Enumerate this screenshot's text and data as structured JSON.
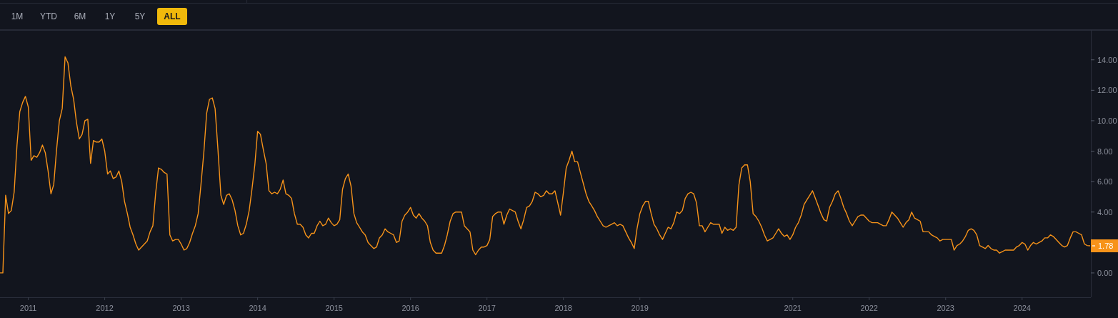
{
  "range_buttons": [
    {
      "label": "1M",
      "selected": false
    },
    {
      "label": "YTD",
      "selected": false
    },
    {
      "label": "6M",
      "selected": false
    },
    {
      "label": "1Y",
      "selected": false
    },
    {
      "label": "5Y",
      "selected": false
    },
    {
      "label": "ALL",
      "selected": true
    }
  ],
  "chart": {
    "current_value_label": "1.78",
    "chart_data": {
      "type": "line",
      "xlim": [
        2010.63,
        2024.89
      ],
      "ylim": [
        -1.6,
        15.96
      ],
      "x": [
        2010.63,
        2010.667,
        2010.704,
        2010.741,
        2010.778,
        2010.815,
        2010.852,
        2010.889,
        2010.926,
        2010.963,
        2011,
        2011.037,
        2011.074,
        2011.111,
        2011.148,
        2011.185,
        2011.222,
        2011.259,
        2011.296,
        2011.333,
        2011.37,
        2011.407,
        2011.444,
        2011.481,
        2011.519,
        2011.556,
        2011.593,
        2011.63,
        2011.667,
        2011.704,
        2011.741,
        2011.778,
        2011.815,
        2011.852,
        2011.889,
        2011.926,
        2011.963,
        2012,
        2012.037,
        2012.074,
        2012.111,
        2012.148,
        2012.185,
        2012.222,
        2012.259,
        2012.296,
        2012.333,
        2012.37,
        2012.407,
        2012.444,
        2012.481,
        2012.519,
        2012.556,
        2012.593,
        2012.63,
        2012.667,
        2012.704,
        2012.741,
        2012.778,
        2012.815,
        2012.852,
        2012.889,
        2012.926,
        2012.963,
        2013,
        2013.037,
        2013.074,
        2013.111,
        2013.148,
        2013.185,
        2013.222,
        2013.259,
        2013.296,
        2013.333,
        2013.37,
        2013.407,
        2013.444,
        2013.481,
        2013.519,
        2013.556,
        2013.593,
        2013.63,
        2013.667,
        2013.704,
        2013.741,
        2013.778,
        2013.815,
        2013.852,
        2013.889,
        2013.926,
        2013.963,
        2014,
        2014.037,
        2014.074,
        2014.111,
        2014.148,
        2014.185,
        2014.222,
        2014.259,
        2014.296,
        2014.333,
        2014.37,
        2014.407,
        2014.444,
        2014.481,
        2014.519,
        2014.556,
        2014.593,
        2014.63,
        2014.667,
        2014.704,
        2014.741,
        2014.778,
        2014.815,
        2014.852,
        2014.889,
        2014.926,
        2014.963,
        2015,
        2015.037,
        2015.074,
        2015.111,
        2015.148,
        2015.185,
        2015.222,
        2015.259,
        2015.296,
        2015.333,
        2015.37,
        2015.407,
        2015.444,
        2015.481,
        2015.519,
        2015.556,
        2015.593,
        2015.63,
        2015.667,
        2015.704,
        2015.741,
        2015.778,
        2015.815,
        2015.852,
        2015.889,
        2015.926,
        2015.963,
        2016,
        2016.037,
        2016.074,
        2016.111,
        2016.148,
        2016.185,
        2016.222,
        2016.259,
        2016.296,
        2016.333,
        2016.37,
        2016.407,
        2016.444,
        2016.481,
        2016.519,
        2016.556,
        2016.593,
        2016.63,
        2016.667,
        2016.704,
        2016.741,
        2016.778,
        2016.815,
        2016.852,
        2016.889,
        2016.926,
        2016.963,
        2017,
        2017.037,
        2017.074,
        2017.111,
        2017.148,
        2017.185,
        2017.222,
        2017.259,
        2017.296,
        2017.333,
        2017.37,
        2017.407,
        2017.444,
        2017.481,
        2017.519,
        2017.556,
        2017.593,
        2017.63,
        2017.667,
        2017.704,
        2017.741,
        2017.778,
        2017.815,
        2017.852,
        2017.889,
        2017.926,
        2017.963,
        2018,
        2018.037,
        2018.074,
        2018.111,
        2018.148,
        2018.185,
        2018.222,
        2018.259,
        2018.296,
        2018.333,
        2018.37,
        2018.407,
        2018.444,
        2018.481,
        2018.519,
        2018.556,
        2018.593,
        2018.63,
        2018.667,
        2018.704,
        2018.741,
        2018.778,
        2018.815,
        2018.852,
        2018.889,
        2018.926,
        2018.963,
        2019,
        2019.037,
        2019.074,
        2019.111,
        2019.148,
        2019.185,
        2019.222,
        2019.259,
        2019.296,
        2019.333,
        2019.37,
        2019.407,
        2019.444,
        2019.481,
        2019.519,
        2019.556,
        2019.593,
        2019.63,
        2019.667,
        2019.704,
        2019.741,
        2019.778,
        2019.815,
        2019.852,
        2019.889,
        2019.926,
        2019.963,
        2020,
        2020.037,
        2020.074,
        2020.111,
        2020.148,
        2020.185,
        2020.222,
        2020.259,
        2020.296,
        2020.333,
        2020.37,
        2020.407,
        2020.444,
        2020.481,
        2020.519,
        2020.556,
        2020.593,
        2020.63,
        2020.667,
        2020.704,
        2020.741,
        2020.778,
        2020.815,
        2020.852,
        2020.889,
        2020.926,
        2020.963,
        2021,
        2021.037,
        2021.074,
        2021.111,
        2021.148,
        2021.185,
        2021.222,
        2021.259,
        2021.296,
        2021.333,
        2021.37,
        2021.407,
        2021.444,
        2021.481,
        2021.519,
        2021.556,
        2021.593,
        2021.63,
        2021.667,
        2021.704,
        2021.741,
        2021.778,
        2021.815,
        2021.852,
        2021.889,
        2021.926,
        2021.963,
        2022,
        2022.037,
        2022.074,
        2022.111,
        2022.148,
        2022.185,
        2022.222,
        2022.259,
        2022.296,
        2022.333,
        2022.37,
        2022.407,
        2022.444,
        2022.481,
        2022.519,
        2022.556,
        2022.593,
        2022.63,
        2022.667,
        2022.704,
        2022.741,
        2022.778,
        2022.815,
        2022.852,
        2022.889,
        2022.926,
        2022.963,
        2023,
        2023.037,
        2023.074,
        2023.111,
        2023.148,
        2023.185,
        2023.222,
        2023.259,
        2023.296,
        2023.333,
        2023.37,
        2023.407,
        2023.444,
        2023.481,
        2023.519,
        2023.556,
        2023.593,
        2023.63,
        2023.667,
        2023.704,
        2023.741,
        2023.778,
        2023.815,
        2023.852,
        2023.889,
        2023.926,
        2023.963,
        2024,
        2024.037,
        2024.074,
        2024.111,
        2024.148,
        2024.185,
        2024.222,
        2024.259,
        2024.296,
        2024.333,
        2024.37,
        2024.407,
        2024.444,
        2024.481,
        2024.519,
        2024.556,
        2024.593,
        2024.63,
        2024.667,
        2024.704,
        2024.741,
        2024.778,
        2024.815,
        2024.852,
        2024.889
      ],
      "xticks": [
        2011,
        2012,
        2013,
        2014,
        2015,
        2016,
        2017,
        2018,
        2019,
        2021,
        2022,
        2023,
        2024
      ],
      "yticks": [
        {
          "value": 0,
          "label": "0.00"
        },
        {
          "value": 4,
          "label": "4.00"
        },
        {
          "value": 6,
          "label": "6.00"
        },
        {
          "value": 8,
          "label": "8.00"
        },
        {
          "value": 10,
          "label": "10.00"
        },
        {
          "value": 12,
          "label": "12.00"
        },
        {
          "value": 14,
          "label": "14.00"
        }
      ],
      "series": [
        {
          "color": "#f7931a",
          "values": [
            0,
            0,
            5.1,
            3.9,
            4.1,
            5.3,
            8.4,
            10.6,
            11.2,
            11.6,
            10.9,
            7.4,
            7.7,
            7.6,
            7.9,
            8.4,
            7.9,
            6.7,
            5.2,
            5.8,
            8.1,
            10.0,
            10.8,
            14.2,
            13.8,
            12.3,
            11.4,
            9.9,
            8.8,
            9.1,
            10.0,
            10.1,
            7.2,
            8.7,
            8.6,
            8.6,
            8.8,
            8.0,
            6.5,
            6.7,
            6.2,
            6.3,
            6.7,
            6.0,
            4.7,
            3.9,
            3.0,
            2.5,
            1.9,
            1.5,
            1.7,
            1.9,
            2.1,
            2.7,
            3.1,
            5.3,
            6.9,
            6.8,
            6.6,
            6.5,
            2.5,
            2.1,
            2.2,
            2.2,
            1.9,
            1.5,
            1.6,
            2.0,
            2.6,
            3.1,
            3.9,
            5.8,
            7.9,
            10.5,
            11.4,
            11.5,
            10.8,
            8.1,
            5.1,
            4.5,
            5.1,
            5.2,
            4.8,
            4.1,
            3.1,
            2.5,
            2.6,
            3.2,
            4.1,
            5.5,
            7.1,
            9.3,
            9.1,
            8.1,
            7.2,
            5.4,
            5.2,
            5.3,
            5.2,
            5.5,
            6.1,
            5.2,
            5.1,
            4.9,
            3.9,
            3.2,
            3.2,
            3.0,
            2.5,
            2.3,
            2.6,
            2.6,
            3.1,
            3.4,
            3.1,
            3.2,
            3.6,
            3.3,
            3.1,
            3.2,
            3.5,
            5.5,
            6.2,
            6.5,
            5.7,
            3.9,
            3.3,
            3.0,
            2.7,
            2.5,
            2.0,
            1.8,
            1.6,
            1.7,
            2.3,
            2.5,
            2.9,
            2.7,
            2.6,
            2.5,
            2.0,
            2.1,
            3.4,
            3.8,
            4.0,
            4.3,
            3.8,
            3.6,
            3.9,
            3.6,
            3.4,
            3.1,
            2.0,
            1.5,
            1.3,
            1.3,
            1.3,
            1.8,
            2.5,
            3.4,
            3.9,
            4.0,
            4.0,
            4.0,
            3.1,
            2.9,
            2.7,
            1.5,
            1.2,
            1.5,
            1.7,
            1.7,
            1.8,
            2.2,
            3.7,
            3.9,
            4.0,
            4.0,
            3.2,
            3.8,
            4.2,
            4.1,
            4.0,
            3.4,
            2.9,
            3.5,
            4.3,
            4.4,
            4.7,
            5.3,
            5.2,
            5.0,
            5.1,
            5.4,
            5.2,
            5.2,
            5.4,
            4.6,
            3.8,
            5.3,
            6.9,
            7.4,
            8.0,
            7.3,
            7.3,
            6.6,
            5.9,
            5.2,
            4.7,
            4.4,
            4.1,
            3.7,
            3.4,
            3.1,
            3.0,
            3.1,
            3.2,
            3.3,
            3.1,
            3.2,
            3.1,
            2.7,
            2.3,
            2.0,
            1.6,
            2.9,
            3.9,
            4.4,
            4.7,
            4.7,
            3.9,
            3.2,
            2.9,
            2.5,
            2.2,
            2.6,
            3.0,
            2.9,
            3.3,
            4.0,
            3.9,
            4.1,
            4.9,
            5.2,
            5.3,
            5.2,
            4.6,
            3.1,
            3.1,
            2.7,
            3.0,
            3.3,
            3.2,
            3.2,
            3.2,
            2.6,
            3.0,
            2.8,
            2.9,
            2.8,
            3.0,
            5.8,
            6.9,
            7.1,
            7.1,
            6.0,
            3.9,
            3.7,
            3.4,
            3.0,
            2.5,
            2.1,
            2.2,
            2.3,
            2.6,
            2.9,
            2.6,
            2.4,
            2.5,
            2.2,
            2.5,
            3.0,
            3.3,
            3.8,
            4.5,
            4.8,
            5.1,
            5.4,
            4.9,
            4.4,
            3.9,
            3.5,
            3.4,
            4.3,
            4.7,
            5.2,
            5.4,
            4.9,
            4.3,
            3.9,
            3.4,
            3.1,
            3.4,
            3.7,
            3.8,
            3.8,
            3.6,
            3.4,
            3.3,
            3.3,
            3.3,
            3.2,
            3.1,
            3.1,
            3.5,
            4.0,
            3.8,
            3.6,
            3.3,
            3.0,
            3.3,
            3.5,
            4.0,
            3.6,
            3.5,
            3.4,
            2.7,
            2.7,
            2.7,
            2.5,
            2.4,
            2.3,
            2.1,
            2.2,
            2.2,
            2.2,
            2.2,
            1.5,
            1.8,
            1.9,
            2.1,
            2.4,
            2.8,
            2.9,
            2.8,
            2.5,
            1.8,
            1.7,
            1.6,
            1.8,
            1.6,
            1.5,
            1.5,
            1.3,
            1.4,
            1.5,
            1.5,
            1.5,
            1.5,
            1.7,
            1.8,
            2.0,
            1.9,
            1.5,
            1.8,
            2.0,
            1.9,
            2.0,
            2.1,
            2.3,
            2.3,
            2.5,
            2.4,
            2.2,
            2.0,
            1.8,
            1.7,
            1.8,
            2.3,
            2.7,
            2.7,
            2.6,
            2.5,
            1.9,
            1.8,
            1.78
          ]
        }
      ]
    }
  }
}
